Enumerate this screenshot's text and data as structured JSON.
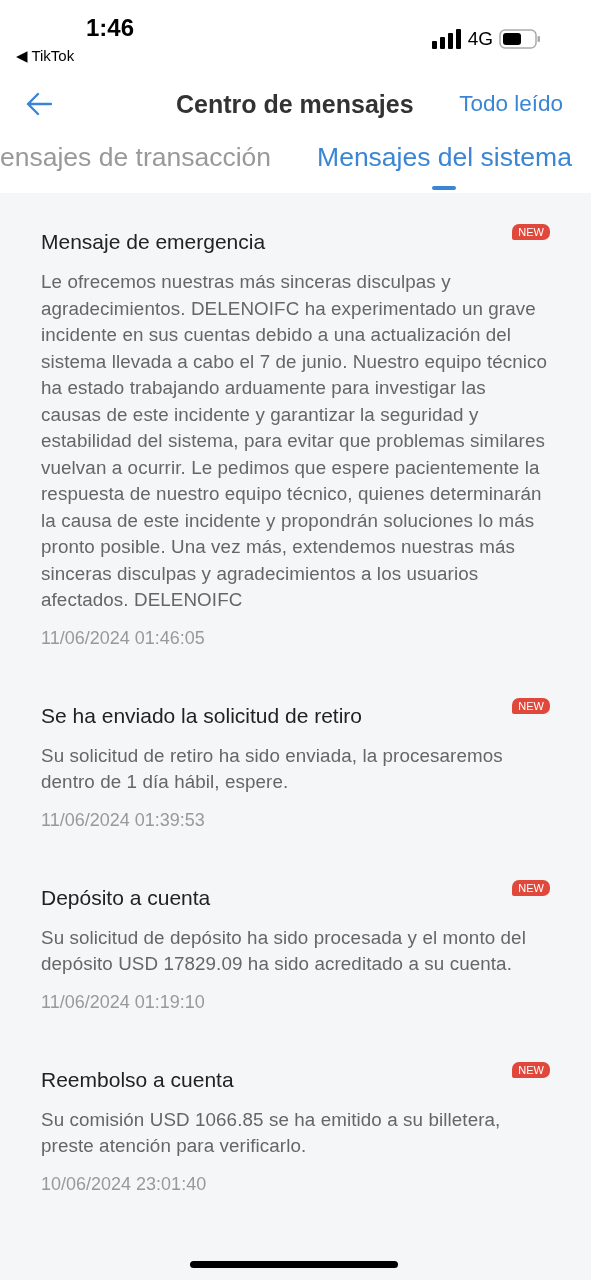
{
  "status_bar": {
    "time": "1:46",
    "back_app": "◀ TikTok",
    "network": "4G"
  },
  "header": {
    "title": "Centro de mensajes",
    "action": "Todo leído"
  },
  "tabs": [
    {
      "label": "ensajes de transacción",
      "selected": false
    },
    {
      "label": "Mensajes del sistema",
      "selected": true
    }
  ],
  "messages": [
    {
      "title": "Mensaje de emergencia",
      "badge": "NEW",
      "body": "Le ofrecemos nuestras más sinceras disculpas y agradecimientos. DELENOIFC ha experimentado un grave incidente en sus cuentas debido a una actualización del sistema llevada a cabo el 7 de junio. Nuestro equipo técnico ha estado trabajando arduamente para investigar las causas de este incidente y garantizar la seguridad y estabilidad del sistema, para evitar que problemas similares vuelvan a ocurrir. Le pedimos que espere pacientemente la respuesta de nuestro equipo técnico, quienes determinarán la causa de este incidente y propondrán soluciones lo más pronto posible. Una vez más, extendemos nuestras más sinceras disculpas y agradecimientos a los usuarios afectados. DELENOIFC",
      "time": "11/06/2024 01:46:05"
    },
    {
      "title": "Se ha enviado la solicitud de retiro",
      "badge": "NEW",
      "body": "Su solicitud de retiro ha sido enviada, la procesaremos dentro de 1 día hábil, espere.",
      "time": "11/06/2024 01:39:53"
    },
    {
      "title": "Depósito a cuenta",
      "badge": "NEW",
      "body": "Su solicitud de depósito ha sido procesada y el monto del depósito USD 17829.09 ha sido acreditado a su cuenta.",
      "time": "11/06/2024 01:19:10"
    },
    {
      "title": "Reembolso a cuenta",
      "badge": "NEW",
      "body": "Su comisión USD 1066.85 se ha emitido a su billetera, preste atención para verificarlo.",
      "time": "10/06/2024 23:01:40"
    }
  ]
}
